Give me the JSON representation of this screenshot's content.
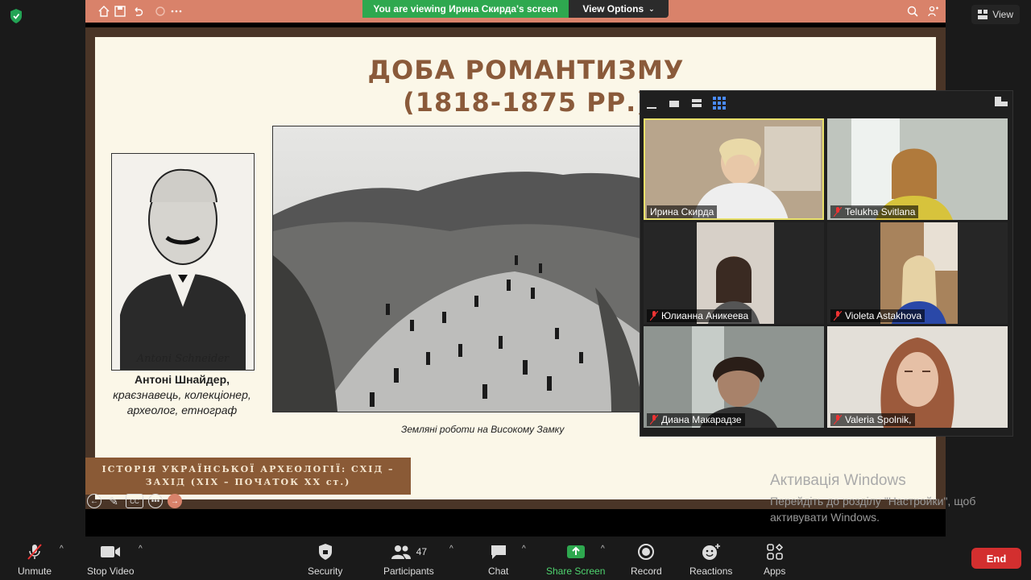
{
  "top": {
    "view_label": "View"
  },
  "share_bar": {
    "viewing_text": "You are viewing Ирина Скирда's screen",
    "view_options": "View Options"
  },
  "slide": {
    "title_line1": "ДОБА РОМАНТИЗМУ",
    "title_line2": "(1818-1875 РР.)",
    "portrait_name": "Антоні Шнайдер,",
    "portrait_desc": "краєзнавець, колекціонер, археолог, етнограф",
    "photo_caption": "Земляні роботи на Високому Замку",
    "banner_line1": "ІСТОРІЯ УКРАЇНСЬКОЇ АРХЕОЛОГІЇ: СХІД –",
    "banner_line2": "ЗАХІД (XIX – ПОЧАТОК XX ст.)",
    "cc_label": "CC"
  },
  "participants": [
    {
      "name": "Ирина Скирда",
      "muted": false,
      "active": true
    },
    {
      "name": "Telukha Svitlana",
      "muted": true
    },
    {
      "name": "Юлианна Аникеева",
      "muted": true
    },
    {
      "name": "Violeta Astakhova",
      "muted": true
    },
    {
      "name": "Диана Макарадзе",
      "muted": true
    },
    {
      "name": "Valeria Spolnik,",
      "muted": true
    }
  ],
  "watermark": {
    "line1": "Активація Windows",
    "line2": "Перейдіть до розділу \"Настройки\", щоб активувати Windows."
  },
  "toolbar": {
    "unmute": "Unmute",
    "stop_video": "Stop Video",
    "security": "Security",
    "participants": "Participants",
    "participants_count": "47",
    "chat": "Chat",
    "share_screen": "Share Screen",
    "record": "Record",
    "reactions": "Reactions",
    "apps": "Apps",
    "end": "End"
  },
  "colors": {
    "share_green": "#2ea84f",
    "end_red": "#d32f2f",
    "slide_brown": "#8a5a3a",
    "active_speaker": "#e8e06a"
  }
}
